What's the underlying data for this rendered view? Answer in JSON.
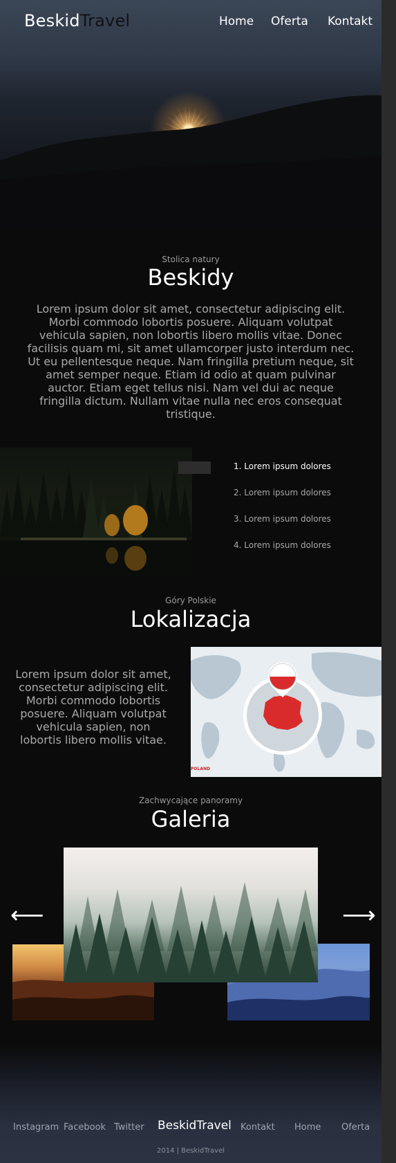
{
  "header": {
    "logo_part1": "Beskid",
    "logo_part2": "Travel",
    "nav": [
      "Home",
      "Oferta",
      "Kontakt"
    ]
  },
  "intro": {
    "eyebrow": "Stolica natury",
    "title": "Beskidy",
    "body": "Lorem ipsum dolor sit amet, consectetur adipiscing elit. Morbi commodo lobortis posuere. Aliquam volutpat vehicula sapien, non lobortis libero mollis vitae. Donec facilisis quam mi, sit amet ullamcorper justo interdum nec. Ut eu pellentesque neque. Nam fringilla pretium neque, sit amet semper neque. Etiam id odio at quam pulvinar auctor. Etiam eget tellus nisi. Nam vel dui ac neque fringilla dictum. Nullam vitae nulla nec eros consequat tristique."
  },
  "feature_list": {
    "items": [
      "1. Lorem ipsum dolores",
      "2. Lorem ipsum dolores",
      "3. Lorem ipsum dolores",
      "4. Lorem ipsum dolores"
    ],
    "active_index": 0
  },
  "location": {
    "eyebrow": "Góry Polskie",
    "title": "Lokalizacja",
    "body": "Lorem ipsum dolor sit amet, consectetur adipiscing elit. Morbi commodo lobortis posuere. Aliquam volutpat vehicula sapien, non lobortis libero mollis vitae.",
    "map_caption": "POLAND"
  },
  "gallery": {
    "eyebrow": "Zachwycające panoramy",
    "title": "Galeria",
    "prev_icon": "arrow-left-icon",
    "next_icon": "arrow-right-icon"
  },
  "footer": {
    "links_left": [
      "Instagram",
      "Facebook",
      "Twitter"
    ],
    "brand": "BeskidTravel",
    "links_right": [
      "Kontakt",
      "Home",
      "Oferta"
    ],
    "copyright": "2014 | BeskidTravel"
  },
  "colors": {
    "background": "#0b0b0c",
    "text_primary": "#ffffff",
    "text_muted": "#a9a9a9",
    "footer_bg": "#2c3242",
    "poland_red": "#d92b2b"
  }
}
